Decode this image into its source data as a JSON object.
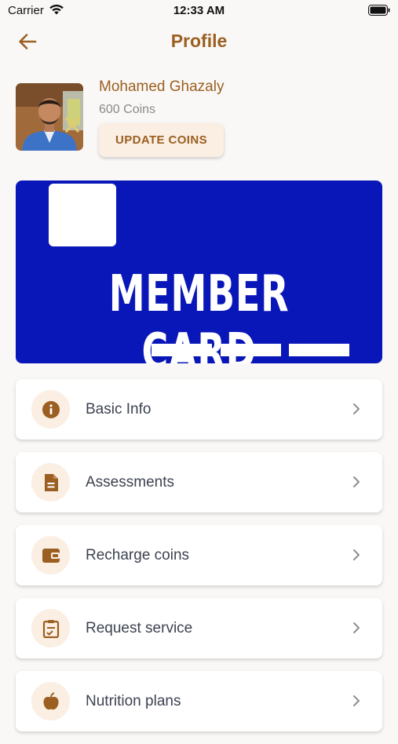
{
  "status_bar": {
    "carrier": "Carrier",
    "time": "12:33 AM"
  },
  "header": {
    "title": "Profile",
    "back_icon": "arrow-left-icon"
  },
  "profile": {
    "name": "Mohamed Ghazaly",
    "coins": "600 Coins",
    "update_button": "UPDATE COINS"
  },
  "member_card": {
    "text": "MEMBER CARD",
    "background_color": "#0a17b8"
  },
  "menu": {
    "items": [
      {
        "label": "Basic Info",
        "icon": "info-icon"
      },
      {
        "label": "Assessments",
        "icon": "document-icon"
      },
      {
        "label": "Recharge coins",
        "icon": "wallet-icon"
      },
      {
        "label": "Request service",
        "icon": "clipboard-icon"
      },
      {
        "label": "Nutrition plans",
        "icon": "apple-icon"
      }
    ]
  },
  "colors": {
    "accent": "#9a5f21",
    "icon_bg": "#fbeee3",
    "page_bg": "#faf8f6"
  }
}
